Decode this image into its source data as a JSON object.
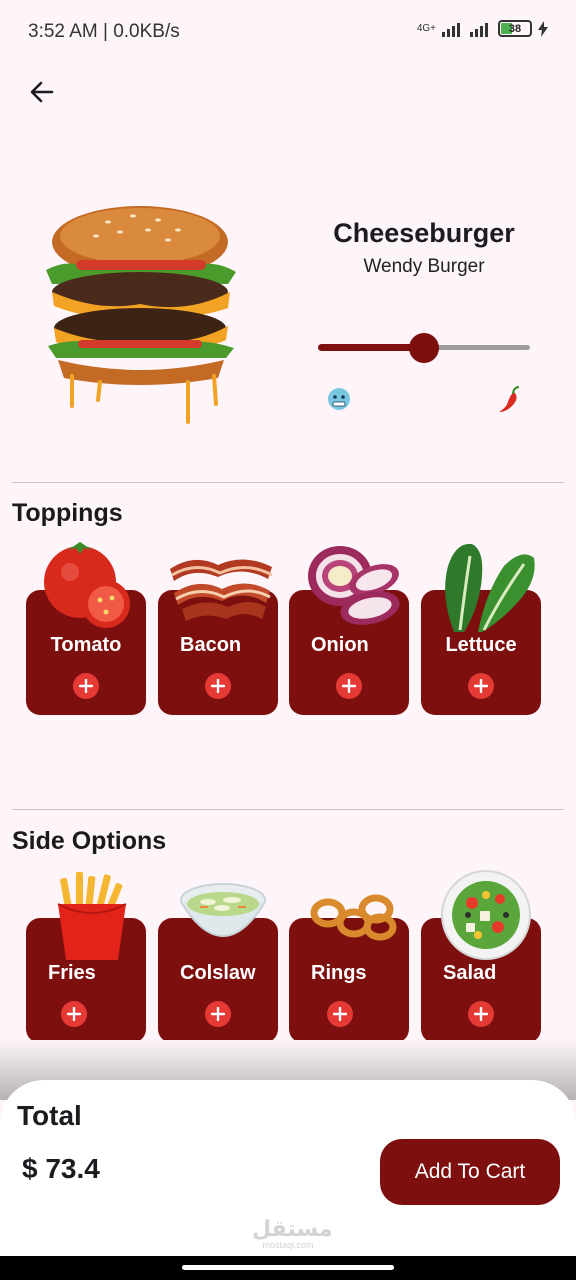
{
  "status": {
    "time_speed": "3:52 AM | 0.0KB/s",
    "network": "4G+",
    "battery": "38"
  },
  "product": {
    "name": "Cheeseburger",
    "brand": "Wendy Burger",
    "spice_level": 0.5,
    "low_icon": "cold-face-icon",
    "high_icon": "chili-pepper-icon"
  },
  "toppings": {
    "title": "Toppings",
    "items": [
      {
        "label": "Tomato",
        "icon": "tomato-icon"
      },
      {
        "label": "Bacon",
        "icon": "bacon-icon"
      },
      {
        "label": "Onion",
        "icon": "onion-icon"
      },
      {
        "label": "Lettuce",
        "icon": "lettuce-icon"
      }
    ]
  },
  "sides": {
    "title": "Side Options",
    "items": [
      {
        "label": "Fries",
        "icon": "fries-icon"
      },
      {
        "label": "Colslaw",
        "icon": "coleslaw-icon"
      },
      {
        "label": "Rings",
        "icon": "onion-rings-icon"
      },
      {
        "label": "Salad",
        "icon": "salad-icon"
      }
    ]
  },
  "footer": {
    "total_label": "Total",
    "total_value": "$ 73.4",
    "cart_button": "Add To Cart"
  },
  "watermark": {
    "arabic": "مستقل",
    "latin": "mostaql.com"
  },
  "colors": {
    "primary": "#7d0f0f",
    "add_button": "#e53935",
    "background": "#fdf5fa"
  }
}
